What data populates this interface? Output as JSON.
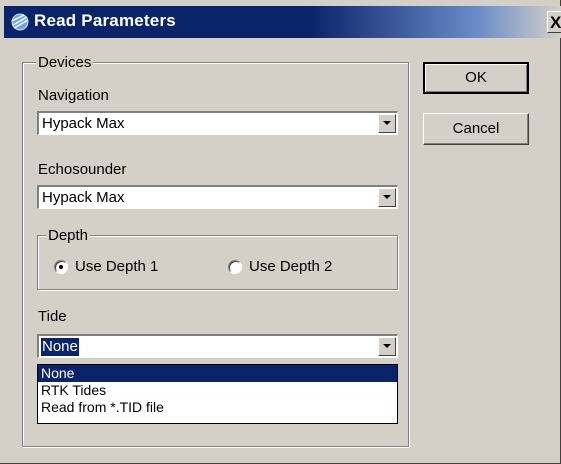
{
  "window": {
    "title": "Read Parameters",
    "close_label": "X",
    "title_bar_color": "#0a246a",
    "face_color": "#d4d0c8"
  },
  "devices_group": {
    "legend": "Devices",
    "navigation": {
      "label": "Navigation",
      "value": "Hypack Max"
    },
    "echosounder": {
      "label": "Echosounder",
      "value": "Hypack Max"
    },
    "depth": {
      "legend": "Depth",
      "options": [
        {
          "label": "Use Depth 1",
          "checked": true
        },
        {
          "label": "Use Depth 2",
          "checked": false
        }
      ]
    },
    "tide": {
      "label": "Tide",
      "value": "None",
      "options": [
        "None",
        "RTK Tides",
        "Read from *.TID file"
      ],
      "highlighted_option": "None"
    }
  },
  "buttons": {
    "ok": "OK",
    "cancel": "Cancel"
  },
  "icons": {
    "title": "app-globe-icon",
    "dropdown": "chevron-down-icon"
  }
}
